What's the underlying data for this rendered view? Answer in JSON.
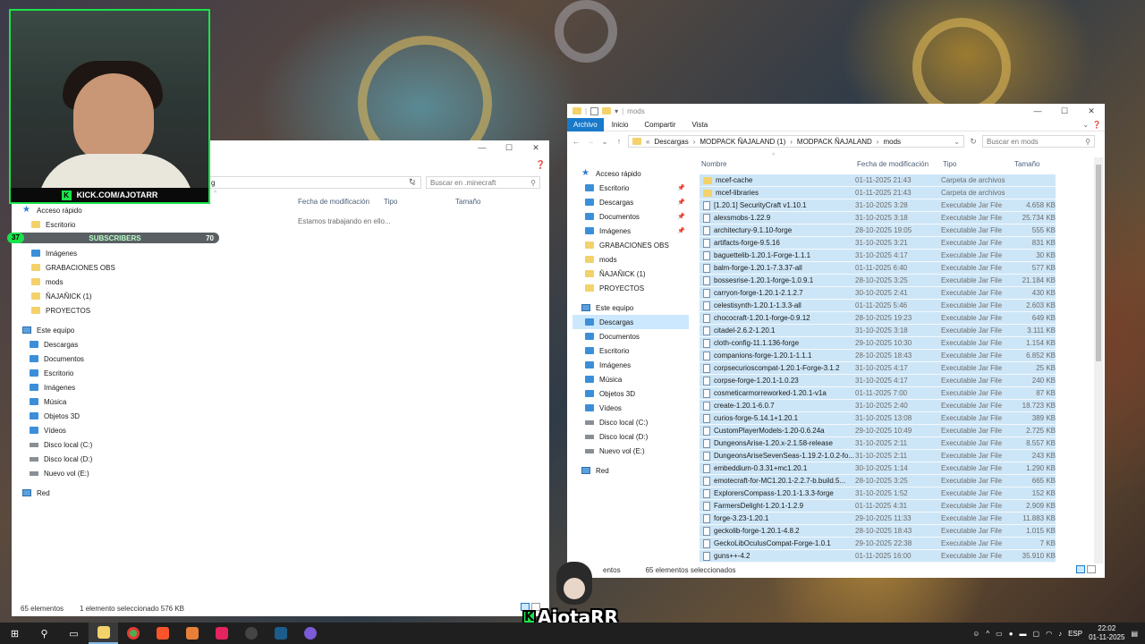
{
  "left_window": {
    "search_placeholder": "Buscar en .minecraft",
    "address_fragment": "g",
    "columns": [
      "Fecha de modificación",
      "Tipo",
      "Tamaño"
    ],
    "empty_message": "Estamos trabajando en ello...",
    "nav": {
      "quick_access": "Acceso rápido",
      "quick_items": [
        {
          "label": "Escritorio",
          "icon": "folder-icon"
        },
        {
          "label": "Documentos",
          "icon": "documents-icon"
        },
        {
          "label": "Imágenes",
          "icon": "pictures-icon"
        },
        {
          "label": "GRABACIONES OBS",
          "icon": "folder-icon"
        },
        {
          "label": "mods",
          "icon": "folder-icon"
        },
        {
          "label": "ÑAJAÑICK (1)",
          "icon": "folder-icon"
        },
        {
          "label": "PROYECTOS",
          "icon": "folder-icon"
        }
      ],
      "this_pc": "Este equipo",
      "pc_items": [
        {
          "label": "Descargas",
          "icon": "downloads-icon"
        },
        {
          "label": "Documentos",
          "icon": "documents-icon"
        },
        {
          "label": "Escritorio",
          "icon": "desktop-icon"
        },
        {
          "label": "Imágenes",
          "icon": "pictures-icon"
        },
        {
          "label": "Música",
          "icon": "music-icon"
        },
        {
          "label": "Objetos 3D",
          "icon": "objects3d-icon"
        },
        {
          "label": "Vídeos",
          "icon": "videos-icon"
        },
        {
          "label": "Disco local (C:)",
          "icon": "drive-icon"
        },
        {
          "label": "Disco local (D:)",
          "icon": "drive-icon"
        },
        {
          "label": "Nuevo vol (E:)",
          "icon": "drive-icon"
        }
      ],
      "network": "Red"
    },
    "status": {
      "count": "65 elementos",
      "selection": "1 elemento seleccionado  576 KB"
    }
  },
  "right_window": {
    "title": "mods",
    "ribbon": [
      "Archivo",
      "Inicio",
      "Compartir",
      "Vista"
    ],
    "breadcrumb": [
      "Descargas",
      "MODPACK ÑAJALAND (1)",
      "MODPACK ÑAJALAND",
      "mods"
    ],
    "search_placeholder": "Buscar en mods",
    "columns": {
      "name": "Nombre",
      "date": "Fecha de modificación",
      "type": "Tipo",
      "size": "Tamaño"
    },
    "nav": {
      "quick_access": "Acceso rápido",
      "quick_items": [
        {
          "label": "Escritorio",
          "icon": "desktop-icon",
          "pinned": true
        },
        {
          "label": "Descargas",
          "icon": "downloads-icon",
          "pinned": true
        },
        {
          "label": "Documentos",
          "icon": "documents-icon",
          "pinned": true
        },
        {
          "label": "Imágenes",
          "icon": "pictures-icon",
          "pinned": true
        },
        {
          "label": "GRABACIONES OBS",
          "icon": "folder-icon",
          "pinned": false
        },
        {
          "label": "mods",
          "icon": "folder-icon",
          "pinned": false
        },
        {
          "label": "ÑAJAÑICK (1)",
          "icon": "folder-icon",
          "pinned": false
        },
        {
          "label": "PROYECTOS",
          "icon": "folder-icon",
          "pinned": false
        }
      ],
      "this_pc": "Este equipo",
      "pc_items": [
        {
          "label": "Descargas",
          "icon": "downloads-icon",
          "selected": true
        },
        {
          "label": "Documentos",
          "icon": "documents-icon"
        },
        {
          "label": "Escritorio",
          "icon": "desktop-icon"
        },
        {
          "label": "Imágenes",
          "icon": "pictures-icon"
        },
        {
          "label": "Música",
          "icon": "music-icon"
        },
        {
          "label": "Objetos 3D",
          "icon": "objects3d-icon"
        },
        {
          "label": "Vídeos",
          "icon": "videos-icon"
        },
        {
          "label": "Disco local (C:)",
          "icon": "drive-icon"
        },
        {
          "label": "Disco local (D:)",
          "icon": "drive-icon"
        },
        {
          "label": "Nuevo vol (E:)",
          "icon": "drive-icon"
        }
      ],
      "network": "Red"
    },
    "files": [
      {
        "name": "mcef-cache",
        "date": "01-11-2025 21:43",
        "type": "Carpeta de archivos",
        "size": "",
        "folder": true
      },
      {
        "name": "mcef-libraries",
        "date": "01-11-2025 21:43",
        "type": "Carpeta de archivos",
        "size": "",
        "folder": true
      },
      {
        "name": "[1.20.1] SecurityCraft v1.10.1",
        "date": "31-10-2025 3:28",
        "type": "Executable Jar File",
        "size": "4.658 KB"
      },
      {
        "name": "alexsmobs-1.22.9",
        "date": "31-10-2025 3:18",
        "type": "Executable Jar File",
        "size": "25.734 KB"
      },
      {
        "name": "architectury-9.1.10-forge",
        "date": "28-10-2025 19:05",
        "type": "Executable Jar File",
        "size": "555 KB"
      },
      {
        "name": "artifacts-forge-9.5.16",
        "date": "31-10-2025 3:21",
        "type": "Executable Jar File",
        "size": "831 KB"
      },
      {
        "name": "baguettelib-1.20.1-Forge-1.1.1",
        "date": "31-10-2025 4:17",
        "type": "Executable Jar File",
        "size": "30 KB"
      },
      {
        "name": "balm-forge-1.20.1-7.3.37-all",
        "date": "01-11-2025 6:40",
        "type": "Executable Jar File",
        "size": "577 KB"
      },
      {
        "name": "bossesrise-1.20.1-forge-1.0.9.1",
        "date": "28-10-2025 3:25",
        "type": "Executable Jar File",
        "size": "21.184 KB"
      },
      {
        "name": "carryon-forge-1.20.1-2.1.2.7",
        "date": "30-10-2025 2:41",
        "type": "Executable Jar File",
        "size": "430 KB"
      },
      {
        "name": "celestisynth-1.20.1-1.3.3-all",
        "date": "01-11-2025 5:46",
        "type": "Executable Jar File",
        "size": "2.603 KB"
      },
      {
        "name": "chococraft-1.20.1-forge-0.9.12",
        "date": "28-10-2025 19:23",
        "type": "Executable Jar File",
        "size": "649 KB"
      },
      {
        "name": "citadel-2.6.2-1.20.1",
        "date": "31-10-2025 3:18",
        "type": "Executable Jar File",
        "size": "3.111 KB"
      },
      {
        "name": "cloth-config-11.1.136-forge",
        "date": "29-10-2025 10:30",
        "type": "Executable Jar File",
        "size": "1.154 KB"
      },
      {
        "name": "companions-forge-1.20.1-1.1.1",
        "date": "28-10-2025 18:43",
        "type": "Executable Jar File",
        "size": "6.852 KB"
      },
      {
        "name": "corpsecurioscompat-1.20.1-Forge-3.1.2",
        "date": "31-10-2025 4:17",
        "type": "Executable Jar File",
        "size": "25 KB"
      },
      {
        "name": "corpse-forge-1.20.1-1.0.23",
        "date": "31-10-2025 4:17",
        "type": "Executable Jar File",
        "size": "240 KB"
      },
      {
        "name": "cosmeticarmorreworked-1.20.1-v1a",
        "date": "01-11-2025 7:00",
        "type": "Executable Jar File",
        "size": "87 KB"
      },
      {
        "name": "create-1.20.1-6.0.7",
        "date": "31-10-2025 2:40",
        "type": "Executable Jar File",
        "size": "18.723 KB"
      },
      {
        "name": "curios-forge-5.14.1+1.20.1",
        "date": "31-10-2025 13:08",
        "type": "Executable Jar File",
        "size": "389 KB"
      },
      {
        "name": "CustomPlayerModels-1.20-0.6.24a",
        "date": "29-10-2025 10:49",
        "type": "Executable Jar File",
        "size": "2.725 KB"
      },
      {
        "name": "DungeonsArise-1.20.x-2.1.58-release",
        "date": "31-10-2025 2:11",
        "type": "Executable Jar File",
        "size": "8.557 KB"
      },
      {
        "name": "DungeonsAriseSevenSeas-1.19.2-1.0.2-fo...",
        "date": "31-10-2025 2:11",
        "type": "Executable Jar File",
        "size": "243 KB"
      },
      {
        "name": "embeddium-0.3.31+mc1.20.1",
        "date": "30-10-2025 1:14",
        "type": "Executable Jar File",
        "size": "1.290 KB"
      },
      {
        "name": "emotecraft-for-MC1.20.1-2.2.7-b.build.5...",
        "date": "28-10-2025 3:25",
        "type": "Executable Jar File",
        "size": "665 KB"
      },
      {
        "name": "ExplorersCompass-1.20.1-1.3.3-forge",
        "date": "31-10-2025 1:52",
        "type": "Executable Jar File",
        "size": "152 KB"
      },
      {
        "name": "FarmersDelight-1.20.1-1.2.9",
        "date": "01-11-2025 4:31",
        "type": "Executable Jar File",
        "size": "2.909 KB"
      },
      {
        "name": "forge-3.23-1.20.1",
        "date": "29-10-2025 11:33",
        "type": "Executable Jar File",
        "size": "11.883 KB"
      },
      {
        "name": "geckolib-forge-1.20.1-4.8.2",
        "date": "28-10-2025 18:43",
        "type": "Executable Jar File",
        "size": "1.015 KB"
      },
      {
        "name": "GeckoLibOculusCompat-Forge-1.0.1",
        "date": "29-10-2025 22:38",
        "type": "Executable Jar File",
        "size": "7 KB"
      },
      {
        "name": "guns++-4.2",
        "date": "01-11-2025 16:00",
        "type": "Executable Jar File",
        "size": "35.910 KB"
      }
    ],
    "status": {
      "count_partial": "entos",
      "selection": "65 elementos seleccionados"
    }
  },
  "overlay": {
    "kick_url": "KICK.COM/AJOTARR",
    "kick_letter": "K",
    "subs_left": "37",
    "subs_label": "SUBSCRIBERS",
    "subs_right": "70",
    "brand_name": "AjotaRR",
    "brand_letter": "K"
  },
  "taskbar": {
    "lang": "ESP",
    "time": "22:02",
    "date": "01-11-2025"
  }
}
